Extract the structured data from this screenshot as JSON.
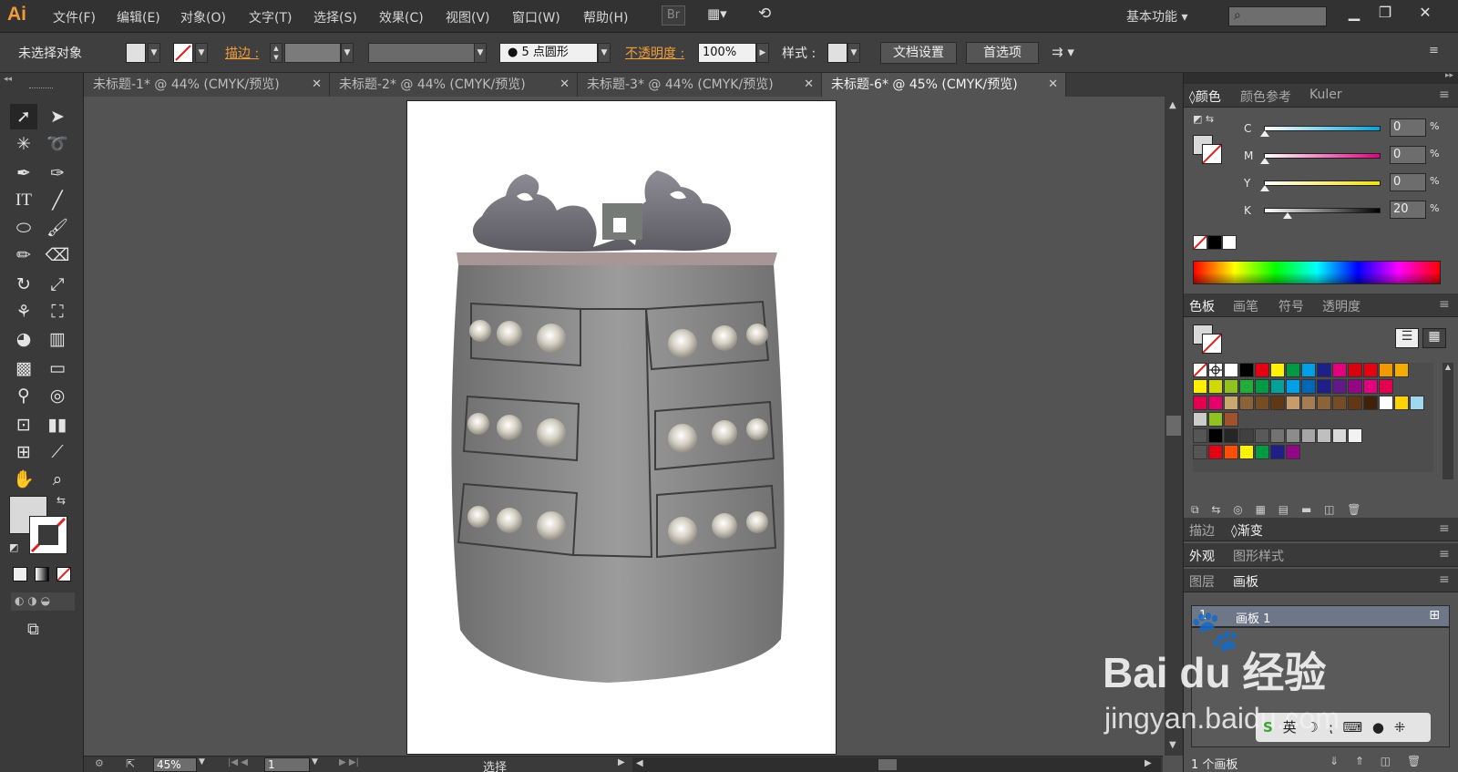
{
  "app": {
    "logo": "Ai"
  },
  "menu": [
    "文件(F)",
    "编辑(E)",
    "对象(O)",
    "文字(T)",
    "选择(S)",
    "效果(C)",
    "视图(V)",
    "窗口(W)",
    "帮助(H)"
  ],
  "menu_extra": {
    "bridge": "Br"
  },
  "workspace": {
    "label": "基本功能"
  },
  "control_bar": {
    "selection_status": "未选择对象",
    "stroke_label": "描边 :",
    "brush_value": "5 点圆形",
    "opacity_label": "不透明度 :",
    "opacity_value": "100%",
    "style_label": "样式 :",
    "doc_settings": "文档设置",
    "preferences": "首选项"
  },
  "tabs": [
    {
      "label": "未标题-1* @ 44% (CMYK/预览)"
    },
    {
      "label": "未标题-2* @ 44% (CMYK/预览)"
    },
    {
      "label": "未标题-3* @ 44% (CMYK/预览)"
    },
    {
      "label": "未标题-6* @ 45% (CMYK/预览)"
    }
  ],
  "color_panel": {
    "tabs": [
      "颜色",
      "颜色参考",
      "Kuler"
    ],
    "channels": [
      {
        "name": "C",
        "value": "0",
        "unit": "%",
        "level": 0
      },
      {
        "name": "M",
        "value": "0",
        "unit": "%",
        "level": 0
      },
      {
        "name": "Y",
        "value": "0",
        "unit": "%",
        "level": 0
      },
      {
        "name": "K",
        "value": "20",
        "unit": "%",
        "level": 0.2
      }
    ]
  },
  "swatches_panel": {
    "tabs": [
      "色板",
      "画笔",
      "符号",
      "透明度"
    ]
  },
  "stroke_panel": {
    "tabs": [
      "描边",
      "渐变"
    ]
  },
  "appearance_panel": {
    "tabs": [
      "外观",
      "图形样式"
    ]
  },
  "layers_panel": {
    "tabs": [
      "图层",
      "画板"
    ],
    "row_index": "1",
    "row_name": "画板 1",
    "footer": "1 个画板"
  },
  "status_bar": {
    "zoom": "45%",
    "artboard_num": "1",
    "tool_status": "选择"
  },
  "watermark": {
    "brand": "Bai du 经验",
    "url": "jingyan.baidu.com"
  }
}
